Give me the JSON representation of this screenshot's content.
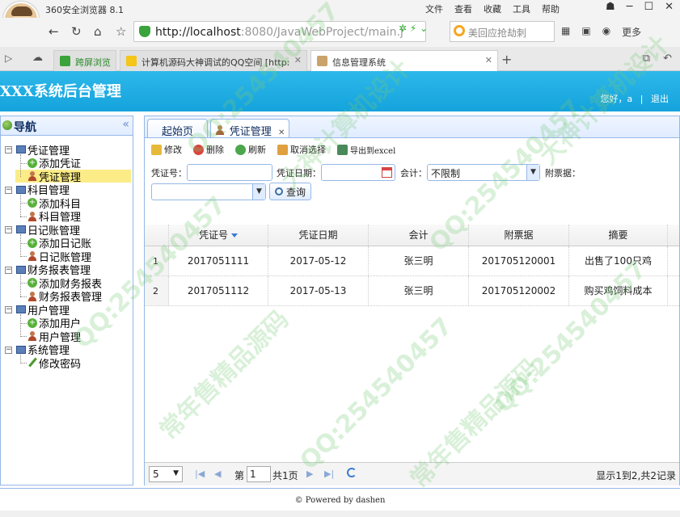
{
  "browser": {
    "name": "360安全浏览器 8.1",
    "menu": [
      "文件",
      "查看",
      "收藏",
      "工具",
      "帮助"
    ],
    "url_host": "http://localhost",
    "url_path": ":8080/JavaWebProject/main.j",
    "search_placeholder": "美回应抢劫刺",
    "more_label": "更多",
    "tabs": [
      {
        "label": "跨屏浏览"
      },
      {
        "label": "计算机源码大神调试的QQ空间 [http:"
      },
      {
        "label": "信息管理系统"
      }
    ]
  },
  "app": {
    "title": "XXX系统后台管理",
    "greeting": "您好，a",
    "logout": "退出"
  },
  "sidebar": {
    "title": "导航",
    "tree": [
      {
        "label": "凭证管理",
        "children": [
          "添加凭证",
          "凭证管理"
        ]
      },
      {
        "label": "科目管理",
        "children": [
          "添加科目",
          "科目管理"
        ]
      },
      {
        "label": "日记账管理",
        "children": [
          "添加日记账",
          "日记账管理"
        ]
      },
      {
        "label": "财务报表管理",
        "children": [
          "添加财务报表",
          "财务报表管理"
        ]
      },
      {
        "label": "用户管理",
        "children": [
          "添加用户",
          "用户管理"
        ]
      },
      {
        "label": "系统管理",
        "children": [
          "修改密码"
        ]
      }
    ]
  },
  "main": {
    "tabs": [
      {
        "label": "起始页"
      },
      {
        "label": "凭证管理"
      }
    ],
    "toolbar": {
      "edit": "修改",
      "delete": "删除",
      "refresh": "刷新",
      "cancel_select": "取消选择",
      "export": "导出到excel"
    },
    "filters": {
      "voucher_no_label": "凭证号：",
      "voucher_date_label": "凭证日期：",
      "accountant_label": "会计：",
      "accountant_value": "不限制",
      "attachments_label": "附票据：",
      "query_label": "查询"
    },
    "grid": {
      "columns": [
        "凭证号",
        "凭证日期",
        "会计",
        "附票据",
        "摘要"
      ],
      "rows": [
        {
          "num": "1",
          "voucher_no": "2017051111",
          "date": "2017-05-12",
          "accountant": "张三明",
          "attachments": "201705120001",
          "summary": "出售了100只鸡"
        },
        {
          "num": "2",
          "voucher_no": "2017051112",
          "date": "2017-05-13",
          "accountant": "张三明",
          "attachments": "201705120002",
          "summary": "购买鸡饲料成本"
        }
      ]
    },
    "pager": {
      "page_size": "5",
      "page_prefix": "第",
      "page_value": "1",
      "page_total": "共1页",
      "info": "显示1到2,共2记录"
    }
  },
  "footer": {
    "text": "© Powered by dashen"
  },
  "watermark": {
    "qq": "QQ:254540457",
    "text1": "常年售精品源码",
    "text2": "大神计算机设计"
  }
}
